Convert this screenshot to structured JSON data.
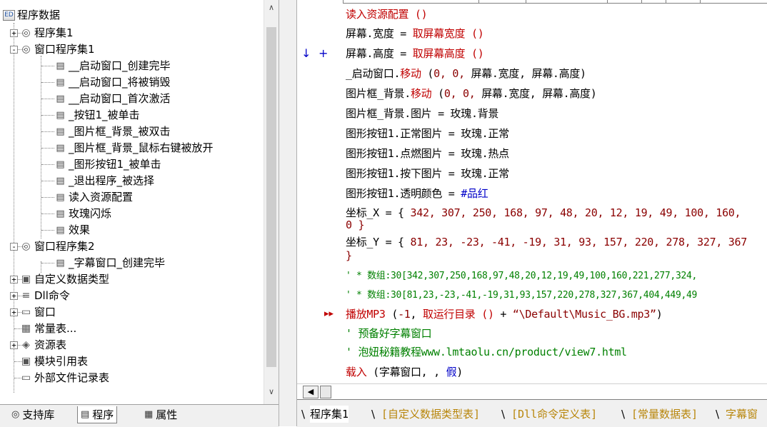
{
  "tree": {
    "root_label": "程序数据",
    "items": [
      {
        "label": "程序集1",
        "expander": "+"
      },
      {
        "label": "窗口程序集1",
        "expander": "-"
      },
      {
        "label": "__启动窗口_创建完毕"
      },
      {
        "label": "__启动窗口_将被销毁"
      },
      {
        "label": "__启动窗口_首次激活"
      },
      {
        "label": "_按钮1_被单击"
      },
      {
        "label": "_图片框_背景_被双击"
      },
      {
        "label": "_图片框_背景_鼠标右键被放开"
      },
      {
        "label": "_图形按钮1_被单击"
      },
      {
        "label": "_退出程序_被选择"
      },
      {
        "label": "读入资源配置"
      },
      {
        "label": "玫瑰闪烁"
      },
      {
        "label": "效果"
      },
      {
        "label": "窗口程序集2",
        "expander": "-"
      },
      {
        "label": "_字幕窗口_创建完毕"
      },
      {
        "label": "自定义数据类型",
        "expander": "+"
      },
      {
        "label": "Dll命令",
        "expander": "+"
      },
      {
        "label": "窗口",
        "expander": "+"
      },
      {
        "label": "常量表..."
      },
      {
        "label": "资源表",
        "expander": "+"
      },
      {
        "label": "模块引用表"
      },
      {
        "label": "外部文件记录表"
      }
    ]
  },
  "left_tabs": [
    {
      "label": "支持库"
    },
    {
      "label": "程序"
    },
    {
      "label": "属性"
    }
  ],
  "code": {
    "lines": [
      {
        "parts": [
          {
            "t": "读入资源配置 ()",
            "c": "red"
          }
        ]
      },
      {
        "parts": [
          {
            "t": "屏幕.宽度 = ",
            "c": "blk"
          },
          {
            "t": "取屏幕宽度 ()",
            "c": "red"
          }
        ]
      },
      {
        "parts": [
          {
            "t": "屏幕.高度 = ",
            "c": "blk"
          },
          {
            "t": "取屏幕高度 ()",
            "c": "red"
          }
        ]
      },
      {
        "parts": [
          {
            "t": "_启动窗口.",
            "c": "blk"
          },
          {
            "t": "移动",
            "c": "red"
          },
          {
            "t": " (",
            "c": "blk"
          },
          {
            "t": "0, 0, ",
            "c": "mar"
          },
          {
            "t": "屏幕.宽度, 屏幕.高度)",
            "c": "blk"
          }
        ]
      },
      {
        "parts": [
          {
            "t": "图片框_背景.",
            "c": "blk"
          },
          {
            "t": "移动",
            "c": "red"
          },
          {
            "t": " (",
            "c": "blk"
          },
          {
            "t": "0, 0, ",
            "c": "mar"
          },
          {
            "t": "屏幕.宽度, 屏幕.高度)",
            "c": "blk"
          }
        ]
      },
      {
        "parts": [
          {
            "t": "图片框_背景.图片 = 玫瑰.背景",
            "c": "blk"
          }
        ]
      },
      {
        "parts": [
          {
            "t": "图形按钮1.正常图片 = 玫瑰.正常",
            "c": "blk"
          }
        ]
      },
      {
        "parts": [
          {
            "t": "图形按钮1.点燃图片 = 玫瑰.热点",
            "c": "blk"
          }
        ]
      },
      {
        "parts": [
          {
            "t": "图形按钮1.按下图片 = 玫瑰.正常",
            "c": "blk"
          }
        ]
      },
      {
        "parts": [
          {
            "t": "图形按钮1.透明颜色 = ",
            "c": "blk"
          },
          {
            "t": "#品红",
            "c": "blue"
          }
        ]
      },
      {
        "parts": [
          {
            "t": "坐标_X = { ",
            "c": "blk"
          },
          {
            "t": "342, 307, 250, 168, 97, 48, 20, 12, 19, 49, 100, 160,",
            "c": "mar"
          }
        ]
      },
      {
        "parts": [
          {
            "t": "0 }",
            "c": "mar"
          }
        ]
      },
      {
        "parts": [
          {
            "t": "坐标_Y = { ",
            "c": "blk"
          },
          {
            "t": "81, 23, -23, -41, -19, 31, 93, 157, 220, 278, 327, 367",
            "c": "mar"
          }
        ]
      },
      {
        "parts": [
          {
            "t": " }",
            "c": "mar"
          }
        ]
      },
      {
        "parts": [
          {
            "t": "' * 数组:30[342,307,250,168,97,48,20,12,19,49,100,160,221,277,324,",
            "c": "grn"
          }
        ]
      },
      {
        "parts": [
          {
            "t": "' * 数组:30[81,23,-23,-41,-19,31,93,157,220,278,327,367,404,449,49",
            "c": "grn"
          }
        ]
      },
      {
        "parts": [
          {
            "t": "播放MP3",
            "c": "red"
          },
          {
            "t": " (",
            "c": "blk"
          },
          {
            "t": "-1",
            "c": "mar"
          },
          {
            "t": ", ",
            "c": "blk"
          },
          {
            "t": "取运行目录 ()",
            "c": "red"
          },
          {
            "t": " + ",
            "c": "blk"
          },
          {
            "t": "“\\Default\\Music_BG.mp3”",
            "c": "mar"
          },
          {
            "t": ")",
            "c": "blk"
          }
        ]
      },
      {
        "parts": [
          {
            "t": "' 预备好字幕窗口",
            "c": "grn"
          }
        ]
      },
      {
        "parts": [
          {
            "t": "' 泡妞秘籍教程www.lmtaolu.cn/product/view7.html",
            "c": "grn"
          }
        ]
      },
      {
        "parts": [
          {
            "t": "载入",
            "c": "red"
          },
          {
            "t": " (字幕窗口, , ",
            "c": "blk"
          },
          {
            "t": "假",
            "c": "blue"
          },
          {
            "t": ")",
            "c": "blk"
          }
        ]
      }
    ],
    "markers": {
      "arrow": "↓",
      "plus": "+",
      "breakpoint": "▸▸"
    }
  },
  "bottom_tabs": [
    {
      "label": "程序集1",
      "active": true
    },
    {
      "label": "[自定义数据类型表]",
      "active": false
    },
    {
      "label": "[Dll命令定义表]",
      "active": false
    },
    {
      "label": "[常量数据表]",
      "active": false
    },
    {
      "label": "字幕窗",
      "active": false
    }
  ],
  "colors": {
    "keyword": "#c00000",
    "number": "#8b0000",
    "comment": "#008000",
    "constant": "#0000c8"
  }
}
